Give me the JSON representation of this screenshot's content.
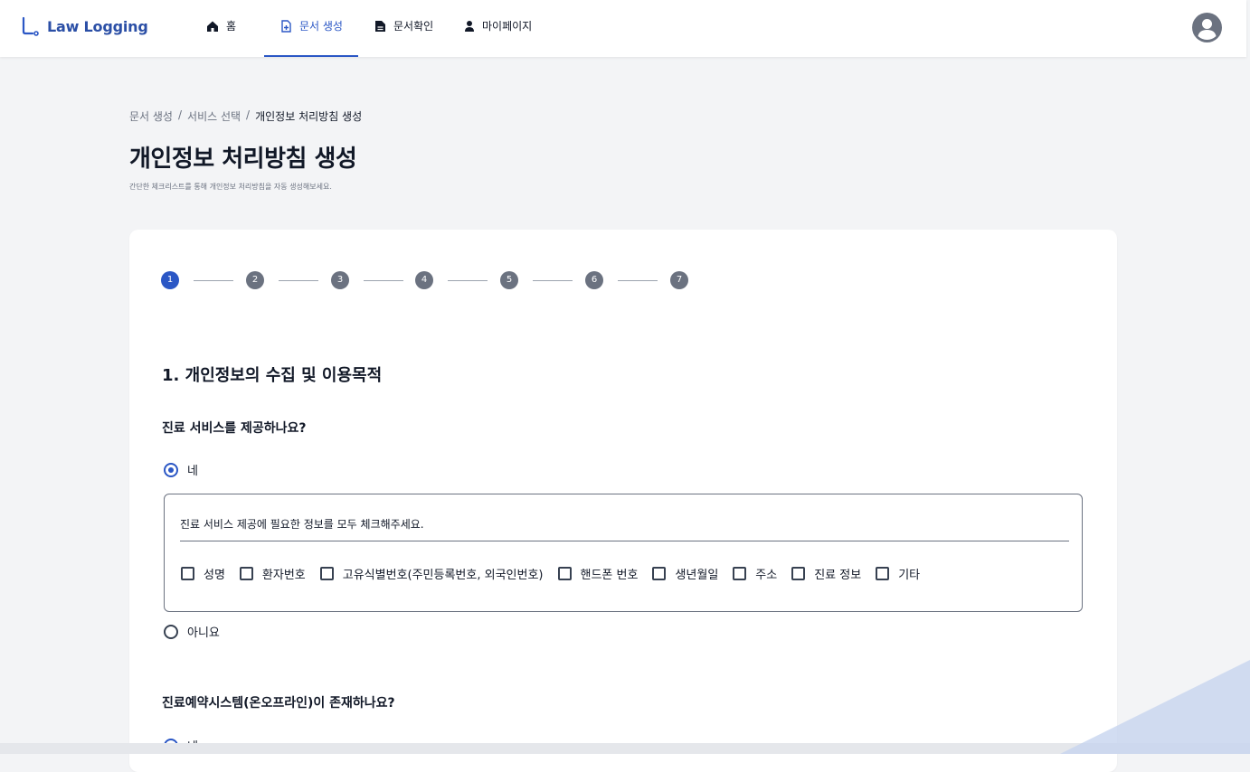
{
  "brand": {
    "name": "Law Logging",
    "accent": "#2b57c5"
  },
  "nav": {
    "items": [
      {
        "label": "홈",
        "icon": "home-icon"
      },
      {
        "label": "문서 생성",
        "icon": "document-plus-icon",
        "active": true
      },
      {
        "label": "문서확인",
        "icon": "document-icon"
      },
      {
        "label": "마이페이지",
        "icon": "person-icon"
      }
    ],
    "avatar_icon": "user-avatar-icon"
  },
  "breadcrumb": {
    "items": [
      "문서 생성",
      "서비스 선택",
      "개인정보 처리방침 생성"
    ],
    "separator": "/"
  },
  "page": {
    "title": "개인정보 처리방침 생성",
    "subtitle": "간단한 체크리스트를 통해 개인정보 처리방침을 자동 생성해보세요."
  },
  "stepper": {
    "steps": [
      "1",
      "2",
      "3",
      "4",
      "5",
      "6",
      "7"
    ],
    "current": 1
  },
  "form": {
    "section_title": "1. 개인정보의 수집 및 이용목적",
    "q1": {
      "question": "진료 서비스를 제공하나요?",
      "yes_label": "네",
      "no_label": "아니요",
      "selected": "yes",
      "detail": {
        "prompt": "진료 서비스 제공에 필요한 정보를 모두 체크해주세요.",
        "options": [
          "성명",
          "환자번호",
          "고유식별번호(주민등록번호, 외국인번호)",
          "핸드폰 번호",
          "생년월일",
          "주소",
          "진료 정보",
          "기타"
        ]
      }
    },
    "q2": {
      "question": "진료예약시스템(온오프라인)이 존재하나요?",
      "yes_label": "네"
    }
  }
}
